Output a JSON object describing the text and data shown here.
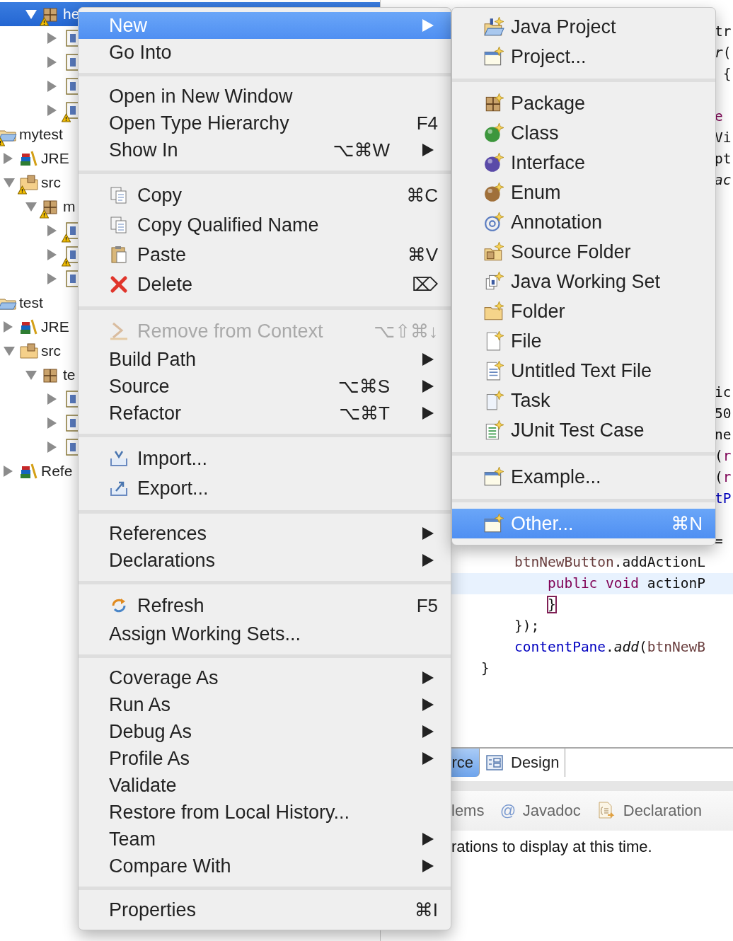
{
  "project_tree": {
    "items": [
      {
        "kind": "continued",
        "children": [
          {
            "kind": "continued",
            "children": [
              {
                "kind": "package",
                "label": "he",
                "expanded": true,
                "selected": true,
                "warning": true,
                "children": [
                  {
                    "kind": "java_file",
                    "expanded": false,
                    "selected": false,
                    "warning": false
                  },
                  {
                    "kind": "java_file",
                    "expanded": false,
                    "selected": false,
                    "warning": false
                  },
                  {
                    "kind": "java_file",
                    "expanded": false,
                    "selected": false,
                    "warning": false
                  },
                  {
                    "kind": "java_file",
                    "expanded": false,
                    "selected": false,
                    "warning": true
                  }
                ]
              }
            ]
          }
        ]
      },
      {
        "kind": "project",
        "label": "mytest",
        "selected": false,
        "warning": true,
        "children": [
          {
            "kind": "library",
            "label": "JRE",
            "expanded": false,
            "selected": false,
            "warning": false
          },
          {
            "kind": "source_folder",
            "label": "src",
            "expanded": true,
            "selected": false,
            "warning": true,
            "children": [
              {
                "kind": "package",
                "label": "m",
                "expanded": true,
                "selected": false,
                "warning": true,
                "children": [
                  {
                    "kind": "java_file",
                    "expanded": false,
                    "selected": false,
                    "warning": true
                  },
                  {
                    "kind": "java_file",
                    "expanded": false,
                    "selected": false,
                    "warning": true
                  },
                  {
                    "kind": "java_file",
                    "expanded": false,
                    "selected": false,
                    "warning": false
                  }
                ]
              }
            ]
          }
        ]
      },
      {
        "kind": "project",
        "label": "test",
        "selected": false,
        "warning": false,
        "children": [
          {
            "kind": "library",
            "label": "JRE",
            "expanded": false,
            "selected": false,
            "warning": false
          },
          {
            "kind": "source_folder",
            "label": "src",
            "expanded": true,
            "selected": false,
            "warning": false,
            "children": [
              {
                "kind": "package",
                "label": "te",
                "expanded": true,
                "selected": false,
                "warning": false,
                "children": [
                  {
                    "kind": "java_file",
                    "expanded": false,
                    "selected": false,
                    "warning": false
                  },
                  {
                    "kind": "java_file",
                    "expanded": false,
                    "selected": false,
                    "warning": false
                  },
                  {
                    "kind": "java_file",
                    "expanded": false,
                    "selected": false,
                    "warning": false
                  }
                ]
              }
            ]
          },
          {
            "kind": "library",
            "label": "Refe",
            "expanded": false,
            "selected": false,
            "warning": false
          }
        ]
      }
    ]
  },
  "editor": {
    "lines": [
      {
        "kind": "fragment",
        "current": false,
        "tokens": [
          {
            "text": "tr",
            "kind": "plain"
          }
        ]
      },
      {
        "kind": "fragment",
        "current": false,
        "tokens": [
          {
            "text": "r",
            "kind": "method"
          },
          {
            "text": "(",
            "kind": "plain"
          }
        ]
      },
      {
        "kind": "fragment",
        "current": false,
        "tokens": [
          {
            "text": " {",
            "kind": "plain"
          }
        ]
      },
      {
        "kind": "blank"
      },
      {
        "kind": "fragment",
        "current": false,
        "tokens": [
          {
            "text": "e",
            "kind": "keyword"
          }
        ]
      },
      {
        "kind": "fragment",
        "current": false,
        "tokens": [
          {
            "text": "Vi",
            "kind": "plain"
          }
        ]
      },
      {
        "kind": "fragment",
        "current": false,
        "tokens": [
          {
            "text": "pt",
            "kind": "plain"
          }
        ]
      },
      {
        "kind": "fragment",
        "current": false,
        "tokens": [
          {
            "text": "ac",
            "kind": "method"
          }
        ]
      },
      {
        "kind": "blank"
      },
      {
        "kind": "blank"
      },
      {
        "kind": "blank"
      },
      {
        "kind": "blank"
      },
      {
        "kind": "blank"
      },
      {
        "kind": "blank"
      },
      {
        "kind": "blank"
      },
      {
        "kind": "blank"
      },
      {
        "kind": "blank"
      },
      {
        "kind": "fragment",
        "current": false,
        "tokens": [
          {
            "text": "ic",
            "kind": "plain"
          }
        ]
      },
      {
        "kind": "fragment",
        "current": false,
        "tokens": [
          {
            "text": "50",
            "kind": "plain"
          }
        ]
      },
      {
        "kind": "fragment",
        "current": false,
        "tokens": [
          {
            "text": "ne",
            "kind": "plain"
          }
        ]
      },
      {
        "kind": "fragment",
        "current": false,
        "tokens": [
          {
            "text": "(",
            "kind": "plain"
          },
          {
            "text": "r",
            "kind": "keyword"
          }
        ]
      },
      {
        "kind": "fragment",
        "current": false,
        "tokens": [
          {
            "text": "(",
            "kind": "plain"
          },
          {
            "text": "r",
            "kind": "keyword"
          }
        ]
      },
      {
        "kind": "fragment",
        "current": false,
        "tokens": [
          {
            "text": "tP",
            "kind": "field"
          }
        ]
      },
      {
        "kind": "blank"
      },
      {
        "kind": "fragment",
        "current": false,
        "tokens": [
          {
            "text": "=",
            "kind": "plain"
          }
        ]
      },
      {
        "kind": "code",
        "current": false,
        "tokens": [
          {
            "text": "    btnNewButton",
            "kind": "local"
          },
          {
            "text": ".addActionL",
            "kind": "plain"
          }
        ]
      },
      {
        "kind": "code",
        "current": true,
        "tokens": [
          {
            "text": "        public void",
            "kind": "keyword"
          },
          {
            "text": " actionP",
            "kind": "plain"
          }
        ]
      },
      {
        "kind": "code",
        "current": false,
        "tokens": [
          {
            "text": "        }",
            "kind": "bracket_match"
          }
        ]
      },
      {
        "kind": "code",
        "current": false,
        "tokens": [
          {
            "text": "    });",
            "kind": "plain"
          }
        ]
      },
      {
        "kind": "code",
        "current": false,
        "tokens": [
          {
            "text": "    contentPane",
            "kind": "field"
          },
          {
            "text": ".",
            "kind": "plain"
          },
          {
            "text": "add",
            "kind": "method"
          },
          {
            "text": "(",
            "kind": "plain"
          },
          {
            "text": "btnNewB",
            "kind": "local"
          }
        ]
      },
      {
        "kind": "code",
        "current": false,
        "tokens": [
          {
            "text": "}",
            "kind": "plain"
          }
        ]
      }
    ],
    "tabs": [
      {
        "label": "rce",
        "kind": "plain",
        "selected": true
      },
      {
        "label": "Design",
        "kind": "design",
        "selected": false
      }
    ]
  },
  "views": {
    "tabs": [
      {
        "label": "lems",
        "kind": "plain"
      },
      {
        "label": "Javadoc",
        "kind": "text_icon",
        "icon_text": "@"
      },
      {
        "label": "Declaration",
        "kind": "declaration"
      }
    ],
    "message": "rations to display at this time."
  },
  "context_menu": {
    "groups": [
      {
        "items": [
          {
            "label": "New",
            "kind": "plain",
            "selected": true,
            "disabled": false,
            "submenu": true
          },
          {
            "label": "Go Into",
            "kind": "plain",
            "selected": false,
            "disabled": false,
            "submenu": false
          }
        ]
      },
      {
        "items": [
          {
            "label": "Open in New Window",
            "kind": "plain",
            "selected": false,
            "disabled": false,
            "submenu": false
          },
          {
            "label": "Open Type Hierarchy",
            "kind": "plain",
            "selected": false,
            "disabled": false,
            "submenu": false,
            "shortcut": "F4"
          },
          {
            "label": "Show In",
            "kind": "plain",
            "selected": false,
            "disabled": false,
            "submenu": true,
            "shortcut": "⌥⌘W"
          }
        ]
      },
      {
        "items": [
          {
            "label": "Copy",
            "kind": "copy",
            "selected": false,
            "disabled": false,
            "submenu": false,
            "shortcut": "⌘C"
          },
          {
            "label": "Copy Qualified Name",
            "kind": "copy_qualified",
            "selected": false,
            "disabled": false,
            "submenu": false
          },
          {
            "label": "Paste",
            "kind": "paste",
            "selected": false,
            "disabled": false,
            "submenu": false,
            "shortcut": "⌘V"
          },
          {
            "label": "Delete",
            "kind": "delete",
            "selected": false,
            "disabled": false,
            "submenu": false,
            "shortcut": "⌦"
          }
        ]
      },
      {
        "items": [
          {
            "label": "Remove from Context",
            "kind": "remove_context",
            "selected": false,
            "disabled": true,
            "submenu": false,
            "shortcut": "⌥⇧⌘↓"
          },
          {
            "label": "Build Path",
            "kind": "plain",
            "selected": false,
            "disabled": false,
            "submenu": true
          },
          {
            "label": "Source",
            "kind": "plain",
            "selected": false,
            "disabled": false,
            "submenu": true,
            "shortcut": "⌥⌘S"
          },
          {
            "label": "Refactor",
            "kind": "plain",
            "selected": false,
            "disabled": false,
            "submenu": true,
            "shortcut": "⌥⌘T"
          }
        ]
      },
      {
        "items": [
          {
            "label": "Import...",
            "kind": "import",
            "selected": false,
            "disabled": false,
            "submenu": false
          },
          {
            "label": "Export...",
            "kind": "export",
            "selected": false,
            "disabled": false,
            "submenu": false
          }
        ]
      },
      {
        "items": [
          {
            "label": "References",
            "kind": "plain",
            "selected": false,
            "disabled": false,
            "submenu": true
          },
          {
            "label": "Declarations",
            "kind": "plain",
            "selected": false,
            "disabled": false,
            "submenu": true
          }
        ]
      },
      {
        "items": [
          {
            "label": "Refresh",
            "kind": "refresh",
            "selected": false,
            "disabled": false,
            "submenu": false,
            "shortcut": "F5"
          },
          {
            "label": "Assign Working Sets...",
            "kind": "plain",
            "selected": false,
            "disabled": false,
            "submenu": false
          }
        ]
      },
      {
        "items": [
          {
            "label": "Coverage As",
            "kind": "plain",
            "selected": false,
            "disabled": false,
            "submenu": true
          },
          {
            "label": "Run As",
            "kind": "plain",
            "selected": false,
            "disabled": false,
            "submenu": true
          },
          {
            "label": "Debug As",
            "kind": "plain",
            "selected": false,
            "disabled": false,
            "submenu": true
          },
          {
            "label": "Profile As",
            "kind": "plain",
            "selected": false,
            "disabled": false,
            "submenu": true
          },
          {
            "label": "Validate",
            "kind": "plain",
            "selected": false,
            "disabled": false,
            "submenu": false
          },
          {
            "label": "Restore from Local History...",
            "kind": "plain",
            "selected": false,
            "disabled": false,
            "submenu": false
          },
          {
            "label": "Team",
            "kind": "plain",
            "selected": false,
            "disabled": false,
            "submenu": true
          },
          {
            "label": "Compare With",
            "kind": "plain",
            "selected": false,
            "disabled": false,
            "submenu": true
          }
        ]
      },
      {
        "items": [
          {
            "label": "Properties",
            "kind": "plain",
            "selected": false,
            "disabled": false,
            "submenu": false,
            "shortcut": "⌘I"
          }
        ]
      }
    ]
  },
  "new_submenu": {
    "groups": [
      {
        "items": [
          {
            "label": "Java Project",
            "kind": "java_project",
            "selected": false
          },
          {
            "label": "Project...",
            "kind": "project_wizard",
            "selected": false
          }
        ]
      },
      {
        "items": [
          {
            "label": "Package",
            "kind": "package",
            "selected": false
          },
          {
            "label": "Class",
            "kind": "class",
            "selected": false
          },
          {
            "label": "Interface",
            "kind": "interface",
            "selected": false
          },
          {
            "label": "Enum",
            "kind": "enum",
            "selected": false
          },
          {
            "label": "Annotation",
            "kind": "annotation",
            "selected": false
          },
          {
            "label": "Source Folder",
            "kind": "source_folder",
            "selected": false
          },
          {
            "label": "Java Working Set",
            "kind": "working_set",
            "selected": false
          },
          {
            "label": "Folder",
            "kind": "folder",
            "selected": false
          },
          {
            "label": "File",
            "kind": "file",
            "selected": false
          },
          {
            "label": "Untitled Text File",
            "kind": "text_file",
            "selected": false
          },
          {
            "label": "Task",
            "kind": "task",
            "selected": false
          },
          {
            "label": "JUnit Test Case",
            "kind": "junit",
            "selected": false
          }
        ]
      },
      {
        "items": [
          {
            "label": "Example...",
            "kind": "example",
            "selected": false
          }
        ]
      },
      {
        "items": [
          {
            "label": "Other...",
            "kind": "other",
            "selected": true,
            "shortcut": "⌘N"
          }
        ]
      }
    ]
  }
}
